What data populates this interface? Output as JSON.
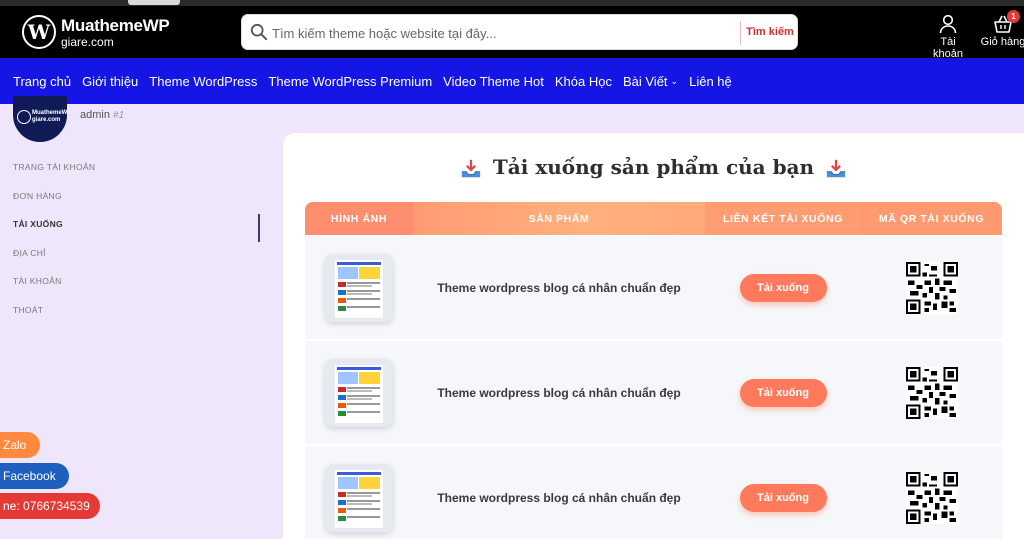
{
  "brand": {
    "line1": "MuathemeWP",
    "line2": "giare.com",
    "mark": "W"
  },
  "search": {
    "placeholder": "Tìm kiếm theme hoặc website tại đây...",
    "button": "Tìm kiếm"
  },
  "header_actions": {
    "account_label": "Tài khoản",
    "cart_label": "Giỏ hàng",
    "cart_count": "1"
  },
  "nav": {
    "items": [
      {
        "label": "Trang chủ"
      },
      {
        "label": "Giới thiệu"
      },
      {
        "label": "Theme WordPress"
      },
      {
        "label": "Theme WordPress Premium"
      },
      {
        "label": "Video Theme Hot"
      },
      {
        "label": "Khóa Học"
      },
      {
        "label": "Bài Viết",
        "has_dropdown": true
      },
      {
        "label": "Liên hệ"
      }
    ]
  },
  "account": {
    "avatar_text": "MuathemeWP giare.com",
    "username": "admin",
    "user_number": "#1",
    "menu": [
      {
        "label": "Trang tài khoản"
      },
      {
        "label": "Đơn hàng"
      },
      {
        "label": "Tải xuống",
        "active": true
      },
      {
        "label": "Địa chỉ"
      },
      {
        "label": "Tài khoản"
      },
      {
        "label": "Thoát"
      }
    ]
  },
  "contacts": {
    "zalo": "Zalo",
    "facebook": "Facebook",
    "phone": "ne: 0766734539"
  },
  "downloads": {
    "title": "Tải xuống sản phẩm của bạn",
    "columns": [
      "Hình ảnh",
      "Sản phẩm",
      "Liên kết tải xuống",
      "Mã QR tải xuống"
    ],
    "rows": [
      {
        "product": "Theme wordpress blog cá nhân chuẩn đẹp",
        "button": "Tải xuống"
      },
      {
        "product": "Theme wordpress blog cá nhân chuẩn đẹp",
        "button": "Tải xuống"
      },
      {
        "product": "Theme wordpress blog cá nhân chuẩn đẹp",
        "button": "Tải xuống"
      }
    ]
  },
  "colors": {
    "nav_bg": "#1515e6",
    "header_bg": "#000000",
    "accent": "#ff7a5c",
    "page_bg": "#efe6fb"
  }
}
